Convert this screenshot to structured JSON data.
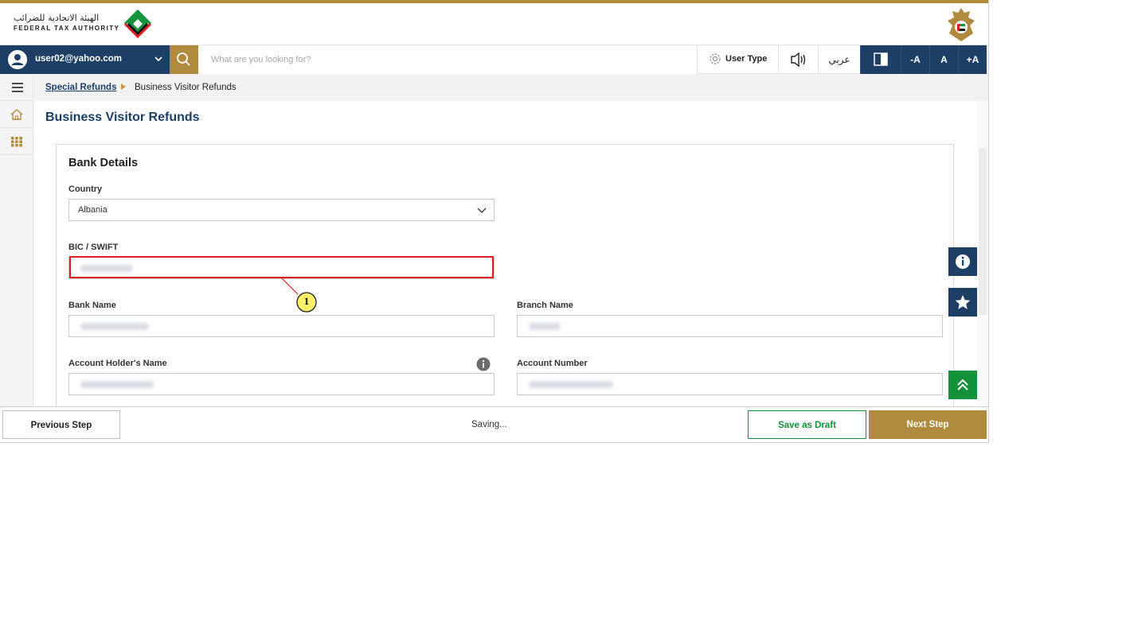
{
  "header": {
    "logo_arabic": "الهيئة الاتحادية للضرائب",
    "logo_english": "FEDERAL TAX AUTHORITY",
    "colors": {
      "gold": "#b08a3e",
      "navy": "#1d3f66",
      "green": "#13913b",
      "red": "#e01e24"
    }
  },
  "navbar": {
    "user_email": "user02@yahoo.com",
    "search_placeholder": "What are you looking for?",
    "user_type_label": "User Type",
    "language_label": "عربي",
    "font_decrease": "-A",
    "font_normal": "A",
    "font_increase": "+A",
    "icons": [
      "user-avatar-icon",
      "chevron-down-icon",
      "search-icon",
      "gear-icon",
      "speaker-icon",
      "contrast-icon"
    ]
  },
  "sidebar": {
    "icons": [
      "hamburger-menu-icon",
      "home-icon",
      "grid-apps-icon"
    ]
  },
  "breadcrumb": {
    "parent": "Special Refunds",
    "current": "Business Visitor Refunds"
  },
  "page": {
    "title": "Business Visitor Refunds"
  },
  "bank_details": {
    "title": "Bank Details",
    "country_label": "Country",
    "country_value": "Albania",
    "bic_label": "BIC / SWIFT",
    "bank_name_label": "Bank Name",
    "branch_name_label": "Branch Name",
    "account_holder_label": "Account Holder's Name",
    "account_number_label": "Account Number"
  },
  "annotation": {
    "marker": "1"
  },
  "floating": {
    "icons": [
      "info-icon",
      "star-icon",
      "scroll-top-icon"
    ]
  },
  "footer": {
    "previous_label": "Previous Step",
    "status": "Saving...",
    "save_draft_label": "Save as Draft",
    "next_label": "Next Step"
  }
}
